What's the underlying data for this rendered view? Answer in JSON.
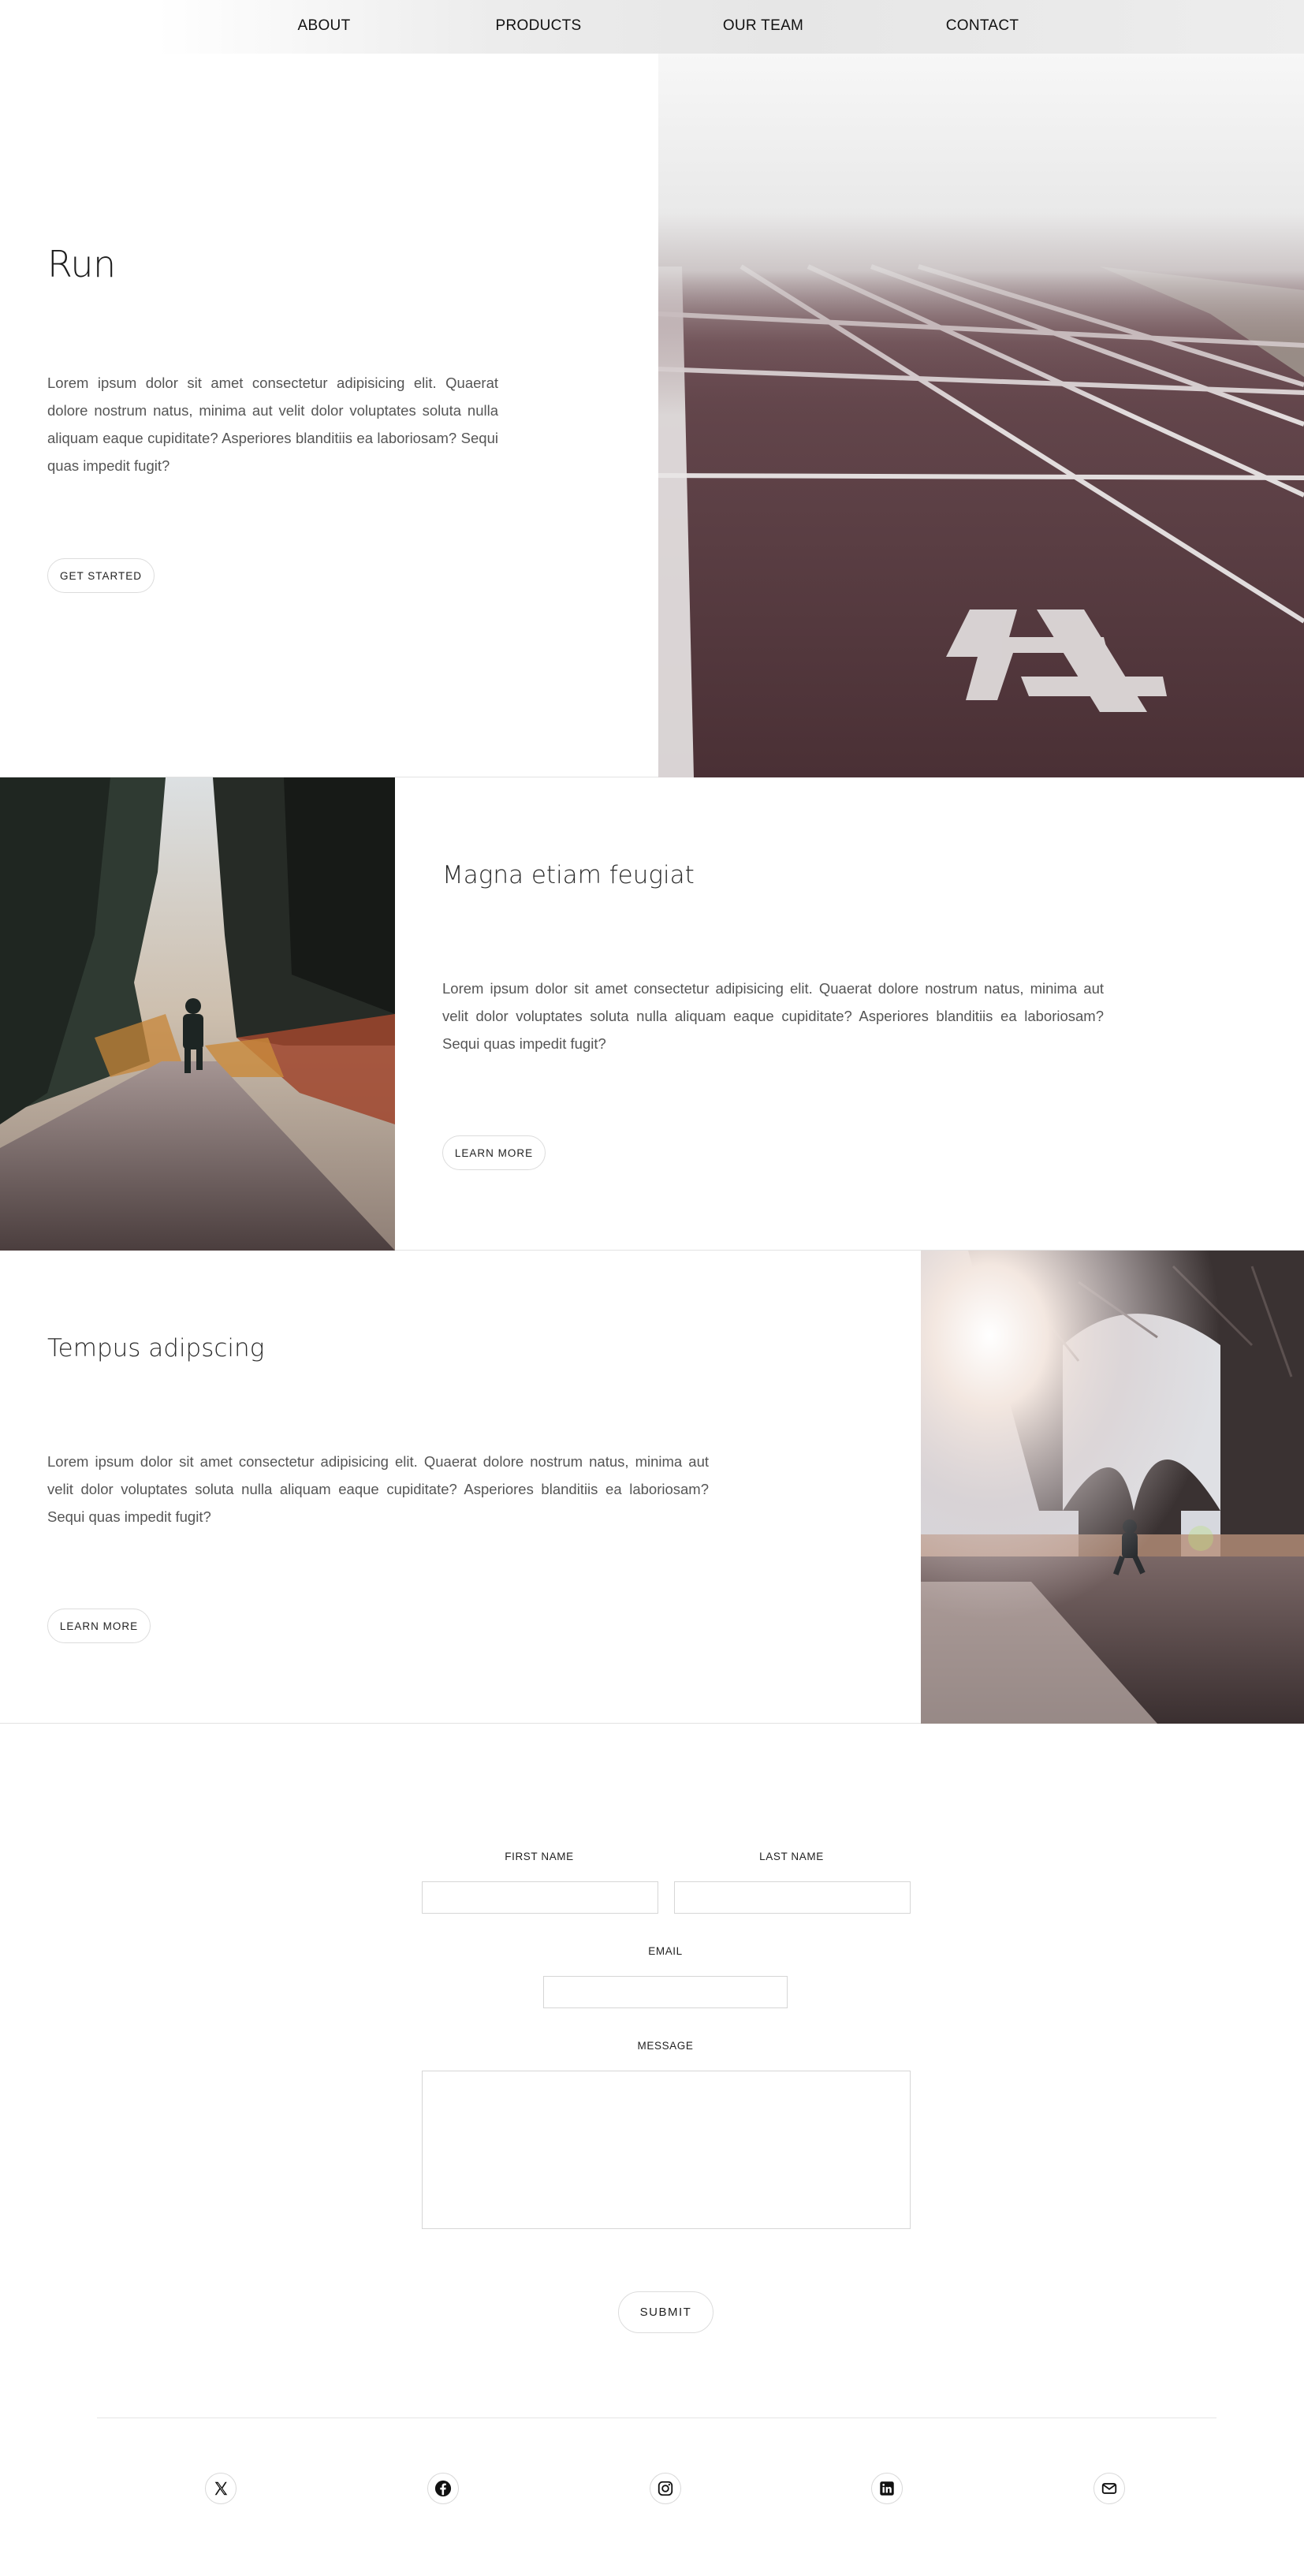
{
  "nav": {
    "items": [
      {
        "label": "ABOUT"
      },
      {
        "label": "PRODUCTS"
      },
      {
        "label": "OUR TEAM"
      },
      {
        "label": "CONTACT"
      }
    ]
  },
  "hero": {
    "title": "Run",
    "body": "Lorem ipsum dolor sit amet consectetur adipisicing elit. Quaerat dolore nostrum natus, minima aut velit dolor voluptates soluta nulla aliquam eaque cupiditate? Asperiores blanditiis ea laboriosam? Sequi quas impedit fugit?",
    "button": "GET STARTED"
  },
  "feature_1": {
    "title": "Magna etiam feugiat",
    "body": "Lorem ipsum dolor sit amet consectetur adipisicing elit. Quaerat dolore nostrum natus, minima aut velit dolor voluptates soluta nulla aliquam eaque cupiditate? Asperiores blanditiis ea laboriosam? Sequi quas impedit fugit?",
    "button": "LEARN MORE"
  },
  "feature_2": {
    "title": "Tempus adipscing",
    "body": "Lorem ipsum dolor sit amet consectetur adipisicing elit. Quaerat dolore nostrum natus, minima aut velit dolor voluptates soluta nulla aliquam eaque cupiditate? Asperiores blanditiis ea laboriosam? Sequi quas impedit fugit?",
    "button": "LEARN MORE"
  },
  "form": {
    "first_name_label": "FIRST NAME",
    "last_name_label": "LAST NAME",
    "email_label": "EMAIL",
    "message_label": "MESSAGE",
    "first_name_value": "",
    "last_name_value": "",
    "email_value": "",
    "message_value": "",
    "submit": "SUBMIT"
  },
  "social": [
    {
      "icon": "x-icon"
    },
    {
      "icon": "facebook-icon"
    },
    {
      "icon": "instagram-icon"
    },
    {
      "icon": "linkedin-icon"
    },
    {
      "icon": "mail-icon"
    }
  ],
  "colors": {
    "background": "#ffffff",
    "text": "#222222",
    "body_text": "#555555",
    "border": "#d6d6d6"
  }
}
